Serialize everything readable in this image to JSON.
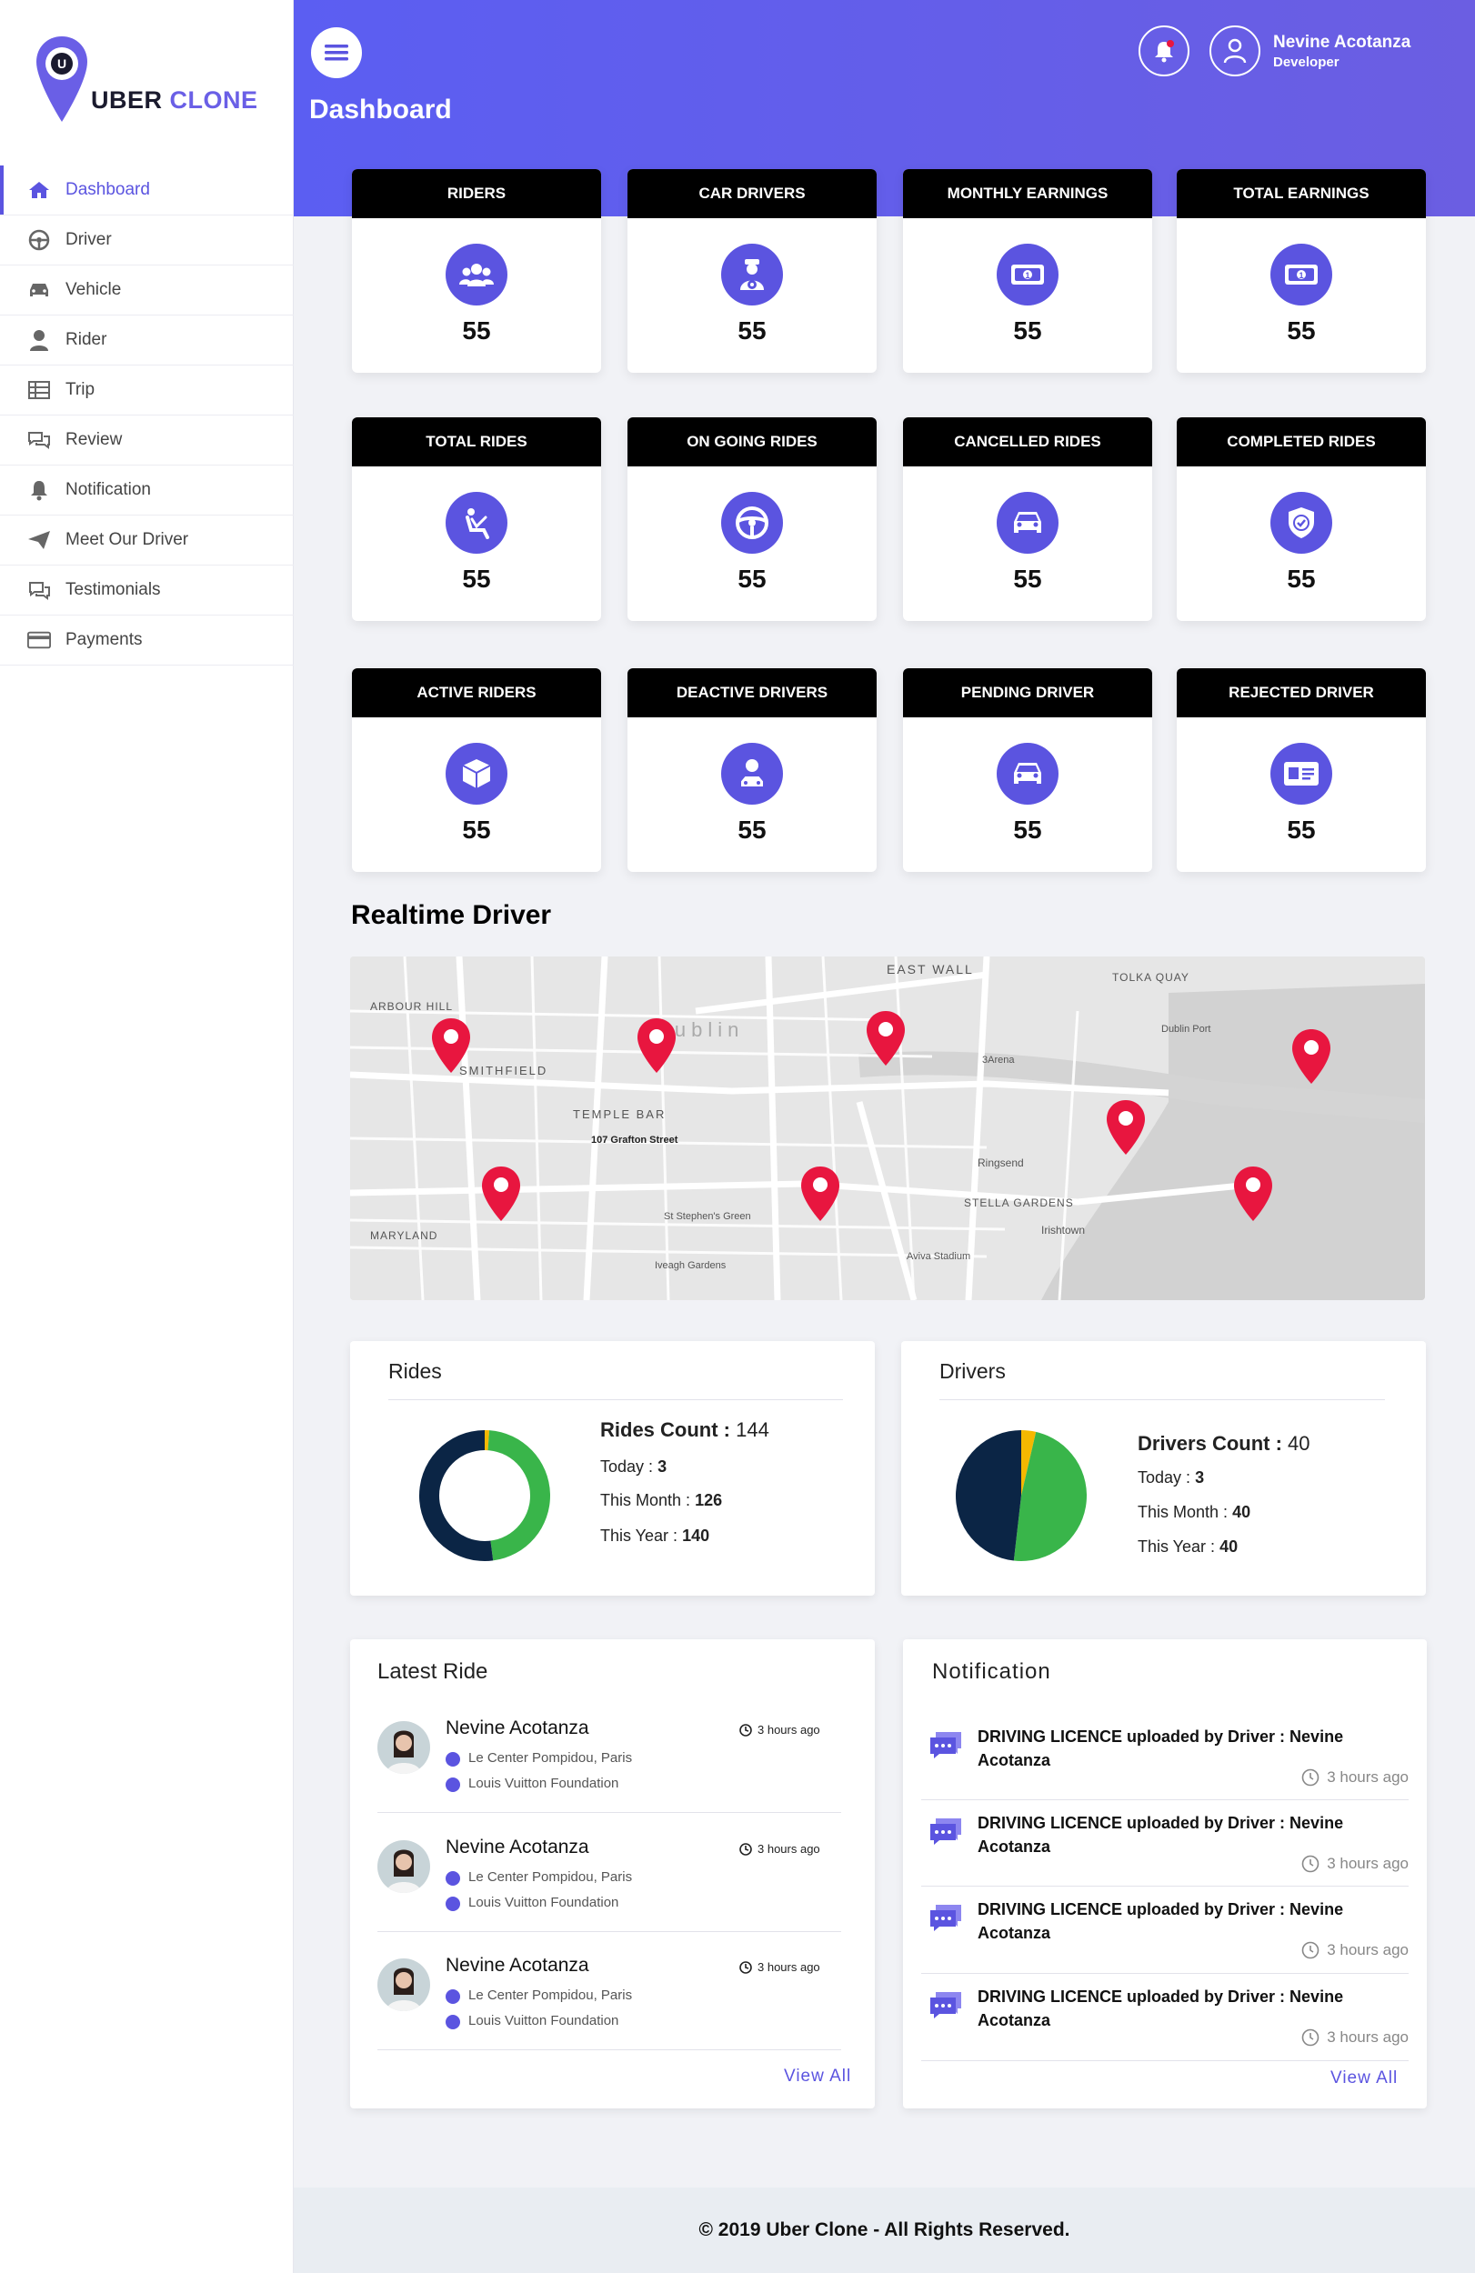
{
  "brand": {
    "word1": "UBER",
    "word2": "CLONE",
    "primary": "#5b54e0",
    "pin": "#e8163f"
  },
  "header": {
    "title": "Dashboard",
    "user_name": "Nevine Acotanza",
    "user_role": "Developer"
  },
  "sidebar": {
    "items": [
      {
        "label": "Dashboard",
        "icon": "home-icon"
      },
      {
        "label": "Driver",
        "icon": "steering-icon"
      },
      {
        "label": "Vehicle",
        "icon": "car-icon"
      },
      {
        "label": "Rider",
        "icon": "user-icon"
      },
      {
        "label": "Trip",
        "icon": "table-icon"
      },
      {
        "label": "Review",
        "icon": "comments-icon"
      },
      {
        "label": "Notification",
        "icon": "bell-icon"
      },
      {
        "label": "Meet Our Driver",
        "icon": "paper-plane-icon"
      },
      {
        "label": "Testimonials",
        "icon": "chat-icon"
      },
      {
        "label": "Payments",
        "icon": "credit-card-icon"
      }
    ]
  },
  "stats": [
    {
      "label": "RIDERS",
      "value": "55",
      "icon": "users-icon"
    },
    {
      "label": "CAR DRIVERS",
      "value": "55",
      "icon": "driver-icon"
    },
    {
      "label": "MONTHLY EARNINGS",
      "value": "55",
      "icon": "money-icon"
    },
    {
      "label": "TOTAL EARNINGS",
      "value": "55",
      "icon": "money-icon"
    },
    {
      "label": "TOTAL RIDES",
      "value": "55",
      "icon": "seat-icon"
    },
    {
      "label": "ON GOING RIDES",
      "value": "55",
      "icon": "steering-icon"
    },
    {
      "label": "CANCELLED RIDES",
      "value": "55",
      "icon": "car-icon"
    },
    {
      "label": "COMPLETED RIDES",
      "value": "55",
      "icon": "shield-check-icon"
    },
    {
      "label": "ACTIVE RIDERS",
      "value": "55",
      "icon": "box-icon"
    },
    {
      "label": "DEACTIVE DRIVERS",
      "value": "55",
      "icon": "driver-icon"
    },
    {
      "label": "PENDING DRIVER",
      "value": "55",
      "icon": "car-icon"
    },
    {
      "label": "REJECTED DRIVER",
      "value": "55",
      "icon": "id-card-icon"
    }
  ],
  "map": {
    "title": "Realtime Driver",
    "labels": [
      "EAST WALL",
      "TOLKA QUAY",
      "ARBOUR HILL",
      "SMITHFIELD",
      "TEMPLE BAR",
      "107 Grafton Street",
      "Ringsend",
      "STELLA GARDENS",
      "Irishtown",
      "MARYLAND",
      "Dublin",
      "Dublin Port",
      "3Arena",
      "St Stephen's Green",
      "Aviva Stadium",
      "Iveagh Gardens"
    ]
  },
  "rides_card": {
    "title": "Rides",
    "count_label": "Rides  Count :",
    "count": "144",
    "today_label": "Today :",
    "today": "3",
    "month_label": "This Month :",
    "month": "126",
    "year_label": "This Year :",
    "year": "140"
  },
  "drivers_card": {
    "title": "Drivers",
    "count_label": "Drivers Count :",
    "count": "40",
    "today_label": "Today :",
    "today": "3",
    "month_label": "This Month :",
    "month": "40",
    "year_label": "This Year :",
    "year": "40"
  },
  "chart_data": [
    {
      "type": "pie",
      "title": "",
      "categories": [
        "Today",
        "This Month",
        "This Year"
      ],
      "values": [
        3,
        126,
        140
      ],
      "colors": [
        "#f5b800",
        "#39b54a",
        "#0b2545"
      ]
    },
    {
      "type": "pie",
      "title": "",
      "categories": [
        "Today",
        "This Month",
        "This Year"
      ],
      "values": [
        3,
        40,
        40
      ],
      "colors": [
        "#f5b800",
        "#39b54a",
        "#0b2545"
      ]
    }
  ],
  "latest_ride": {
    "title": "Latest Ride",
    "view_all": "View All",
    "items": [
      {
        "name": "Nevine Acotanza",
        "from": "Le Center Pompidou, Paris",
        "to": "Louis Vuitton Foundation",
        "time": "3 hours ago"
      },
      {
        "name": "Nevine Acotanza",
        "from": "Le Center Pompidou, Paris",
        "to": "Louis Vuitton Foundation",
        "time": "3 hours ago"
      },
      {
        "name": "Nevine Acotanza",
        "from": "Le Center Pompidou, Paris",
        "to": "Louis Vuitton Foundation",
        "time": "3 hours ago"
      }
    ]
  },
  "notifications": {
    "title": "Notification",
    "view_all": "View All",
    "items": [
      {
        "text": "DRIVING LICENCE uploaded by Driver : Nevine Acotanza",
        "time": "3 hours ago"
      },
      {
        "text": "DRIVING LICENCE uploaded by Driver : Nevine Acotanza",
        "time": "3 hours ago"
      },
      {
        "text": "DRIVING LICENCE uploaded by Driver : Nevine Acotanza",
        "time": "3 hours ago"
      },
      {
        "text": "DRIVING LICENCE uploaded by Driver : Nevine Acotanza",
        "time": "3 hours ago"
      }
    ]
  },
  "footer": {
    "text": "© 2019 Uber Clone - All Rights Reserved."
  }
}
